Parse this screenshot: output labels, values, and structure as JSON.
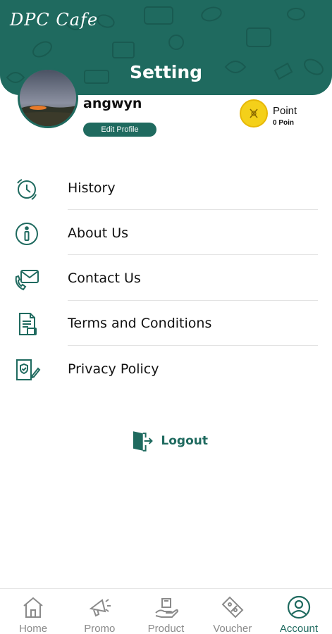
{
  "header": {
    "brand": "DPC Cafe",
    "title": "Setting"
  },
  "profile": {
    "username": "angwyn",
    "edit_label": "Edit Profile",
    "point_label": "Point",
    "point_value": "0 Poin"
  },
  "menu": [
    {
      "label": "History",
      "icon": "history-icon"
    },
    {
      "label": "About Us",
      "icon": "info-icon"
    },
    {
      "label": "Contact Us",
      "icon": "contact-icon"
    },
    {
      "label": "Terms and Conditions",
      "icon": "document-icon"
    },
    {
      "label": "Privacy Policy",
      "icon": "privacy-icon"
    }
  ],
  "logout": {
    "label": "Logout"
  },
  "bottom_nav": [
    {
      "label": "Home",
      "icon": "home-icon",
      "active": false
    },
    {
      "label": "Promo",
      "icon": "megaphone-icon",
      "active": false
    },
    {
      "label": "Product",
      "icon": "product-hand-icon",
      "active": false
    },
    {
      "label": "Voucher",
      "icon": "voucher-icon",
      "active": false
    },
    {
      "label": "Account",
      "icon": "account-icon",
      "active": true
    }
  ],
  "colors": {
    "primary": "#1f6a5f",
    "coin": "#f4d01a",
    "inactive": "#8a8a8a"
  }
}
